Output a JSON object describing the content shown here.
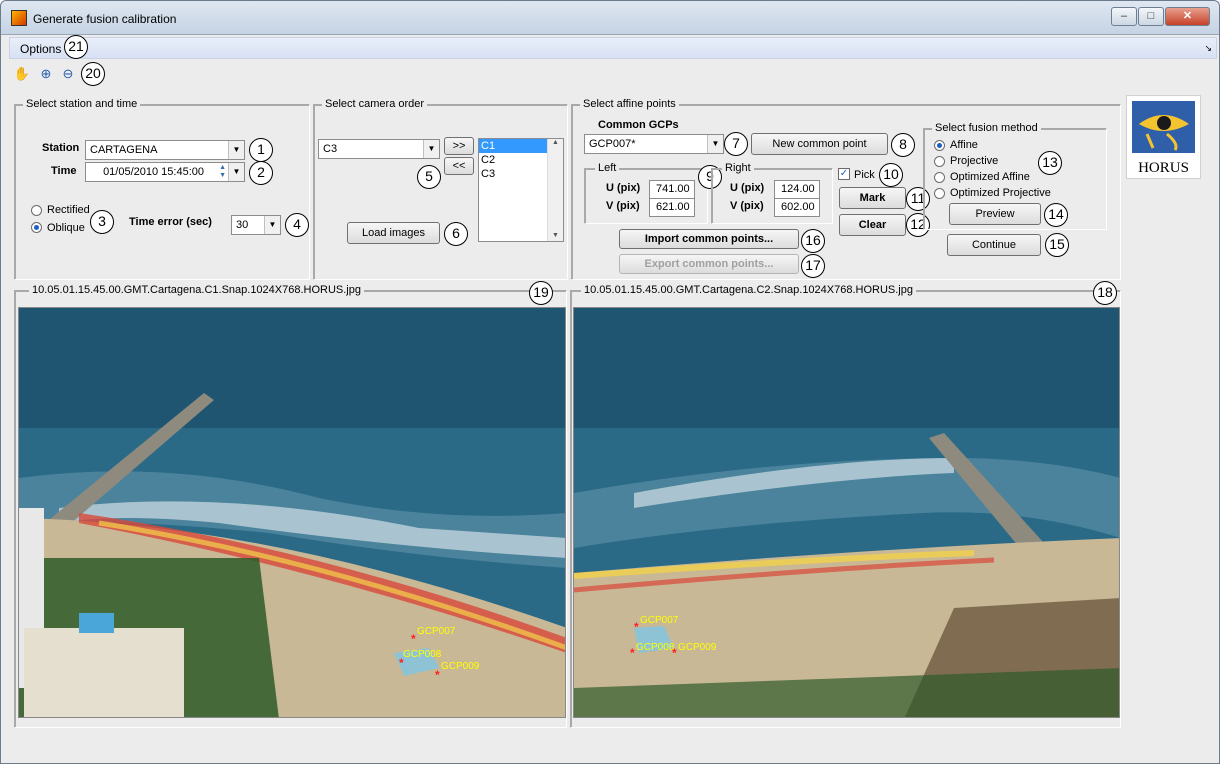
{
  "window": {
    "title": "Generate fusion calibration"
  },
  "menu": {
    "options_label": "Options"
  },
  "toolbar": {
    "icons": [
      "pan-hand-icon",
      "zoom-in-icon",
      "zoom-out-icon"
    ]
  },
  "station_panel": {
    "title": "Select station and time",
    "station_label": "Station",
    "station_value": "CARTAGENA",
    "time_label": "Time",
    "time_value": "01/05/2010 15:45:00",
    "rectified_label": "Rectified",
    "oblique_label": "Oblique",
    "selected_mode": "Oblique",
    "time_error_label": "Time error (sec)",
    "time_error_value": "30"
  },
  "camera_panel": {
    "title": "Select camera order",
    "camera_value": "C3",
    "add_label": ">>",
    "remove_label": "<<",
    "order_list": [
      "C1",
      "C2",
      "C3"
    ],
    "selected_index": 0,
    "load_images_label": "Load images"
  },
  "affine_panel": {
    "title": "Select affine points",
    "common_gcps_label": "Common GCPs",
    "gcp_value": "GCP007*",
    "new_common_point_label": "New common point",
    "left_label": "Left",
    "right_label": "Right",
    "u_label": "U (pix)",
    "v_label": "V (pix)",
    "left_u": "741.00",
    "left_v": "621.00",
    "right_u": "124.00",
    "right_v": "602.00",
    "pick_label": "Pick",
    "pick_checked": true,
    "mark_label": "Mark",
    "clear_label": "Clear",
    "import_label": "Import common points...",
    "export_label": "Export common points..."
  },
  "fusion_panel": {
    "title": "Select fusion method",
    "methods": [
      "Affine",
      "Projective",
      "Optimized Affine",
      "Optimized Projective"
    ],
    "selected": "Affine",
    "preview_label": "Preview",
    "continue_label": "Continue"
  },
  "logo": {
    "text": "HORUS"
  },
  "left_image": {
    "filename": "10.05.01.15.45.00.GMT.Cartagena.C1.Snap.1024X768.HORUS.jpg",
    "points": [
      "GCP007",
      "GCP008",
      "GCP009"
    ]
  },
  "right_image": {
    "filename": "10.05.01.15.45.00.GMT.Cartagena.C2.Snap.1024X768.HORUS.jpg",
    "points": [
      "GCP007",
      "GCP008",
      "GCP009"
    ]
  },
  "callouts": [
    "1",
    "2",
    "3",
    "4",
    "5",
    "6",
    "7",
    "8",
    "9",
    "10",
    "11",
    "12",
    "13",
    "14",
    "15",
    "16",
    "17",
    "18",
    "19",
    "20",
    "21"
  ],
  "colors": {
    "marker": "#ff2020",
    "marker_label": "#ffff00",
    "selection": "#3399ff"
  }
}
